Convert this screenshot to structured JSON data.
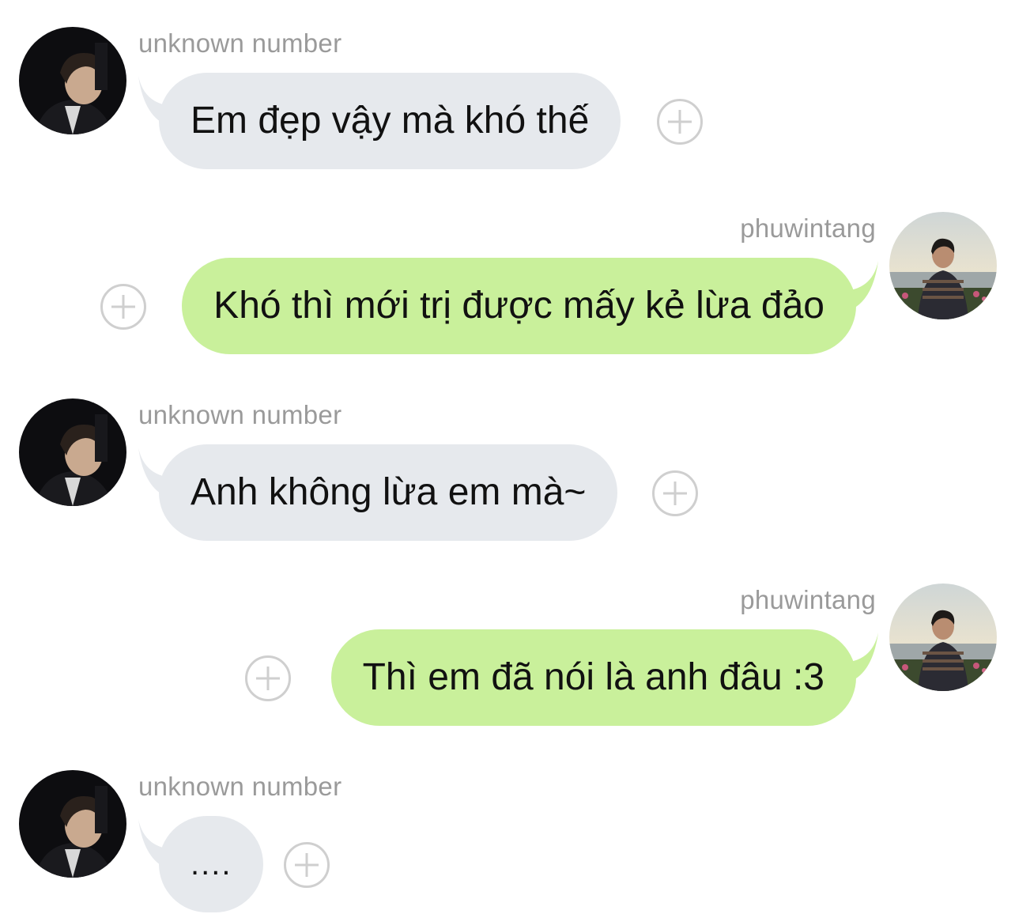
{
  "messages": [
    {
      "sender": "unknown number",
      "text": "Em đẹp vậy mà khó thế"
    },
    {
      "sender": "phuwintang",
      "text": "Khó thì mới trị được mấy kẻ lừa đảo"
    },
    {
      "sender": "unknown number",
      "text": "Anh không lừa em mà~"
    },
    {
      "sender": "phuwintang",
      "text": "Thì em đã nói là anh đâu :3"
    },
    {
      "sender": "unknown number",
      "text": "...."
    }
  ],
  "colors": {
    "incoming_bubble": "#e6e9ed",
    "outgoing_bubble": "#c9f09b",
    "sender_name": "#9a9a9a",
    "add_icon": "#cfcfcf"
  },
  "icons": {
    "add_reaction": "plus-circle-icon"
  }
}
